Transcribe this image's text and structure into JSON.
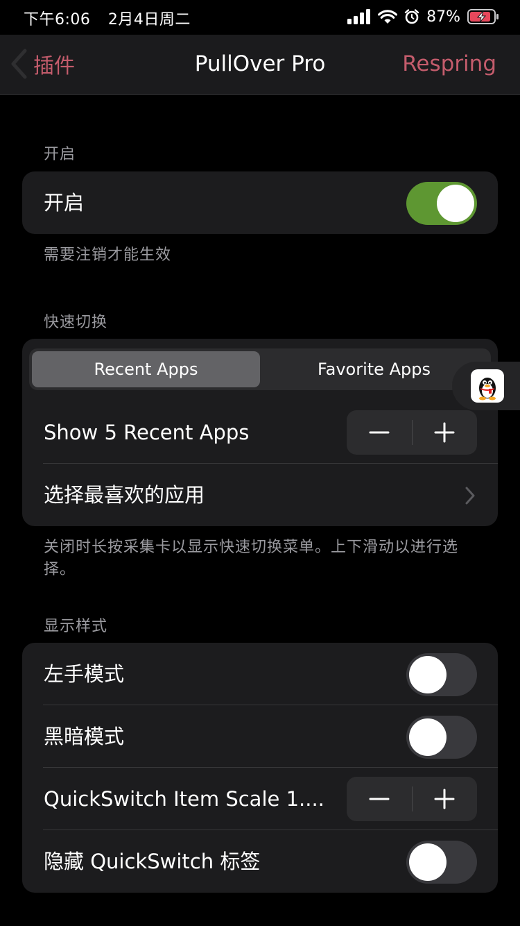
{
  "status_bar": {
    "time": "下午6:06",
    "date": "2月4日周二",
    "battery": "87%"
  },
  "nav": {
    "back_label": "插件",
    "title": "PullOver Pro",
    "action_label": "Respring"
  },
  "sections": {
    "enable": {
      "header": "开启",
      "rows": {
        "enable": {
          "label": "开启",
          "toggle": "on"
        }
      },
      "footer": "需要注销才能生效"
    },
    "quick_switch": {
      "header": "快速切换",
      "segments": [
        "Recent Apps",
        "Favorite Apps"
      ],
      "selected_segment": "Recent Apps",
      "rows": {
        "recent_count": {
          "label": "Show 5 Recent Apps"
        },
        "favorites": {
          "label": "选择最喜欢的应用"
        }
      },
      "footer": "关闭时长按采集卡以显示快速切换菜单。上下滑动以进行选择。"
    },
    "display": {
      "header": "显示样式",
      "rows": {
        "left_hand": {
          "label": "左手模式",
          "toggle": "off"
        },
        "dark_mode": {
          "label": "黑暗模式",
          "toggle": "off"
        },
        "item_scale": {
          "label": "QuickSwitch Item Scale 1...."
        },
        "hide_labels": {
          "label": "隐藏 QuickSwitch 标签",
          "toggle": "off"
        }
      }
    }
  },
  "colors": {
    "accent": "#c45c6c",
    "toggle_on": "#5e9732",
    "group_bg": "#1c1c1e"
  },
  "icons": [
    "signal-icon",
    "wifi-icon",
    "alarm-icon",
    "battery-charging-icon",
    "chevron-left-icon",
    "minus-icon",
    "plus-icon",
    "chevron-right-icon",
    "qq-penguin-icon"
  ]
}
